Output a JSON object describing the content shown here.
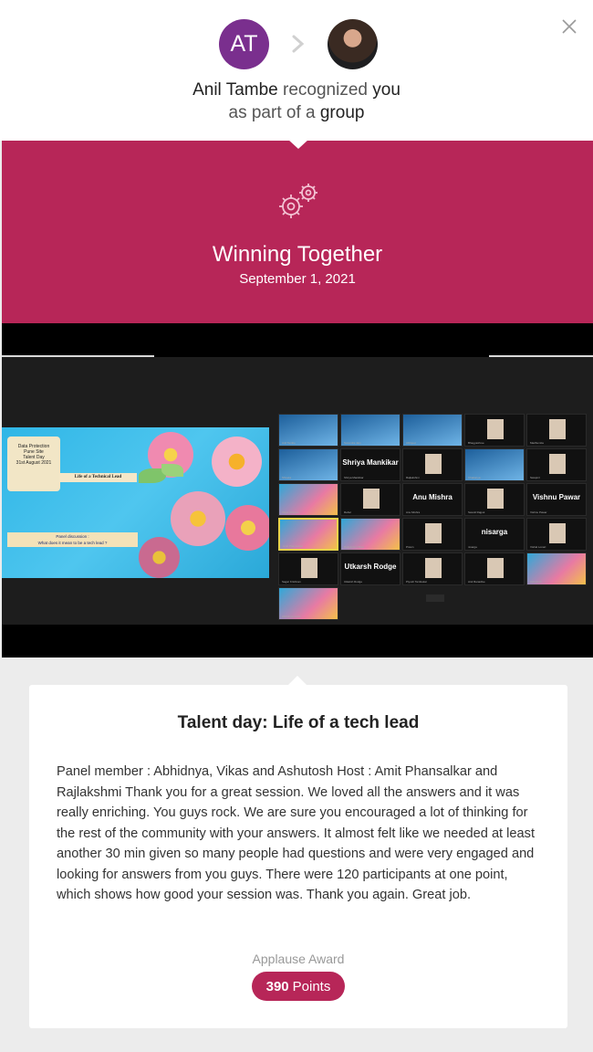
{
  "header": {
    "giver_initials": "AT",
    "giver_name": "Anil Tambe",
    "recognized_text": "recognized",
    "recipient": "you",
    "line2_prefix": "as part of a",
    "line2_group": "group"
  },
  "award": {
    "title": "Winning Together",
    "date": "September 1, 2021",
    "icon": "gears-icon"
  },
  "media": {
    "slide": {
      "scroll_lines": [
        "Data Protection",
        "Pune Site",
        "Talent Day",
        "31st August 2021"
      ],
      "title": "Life of a Technical Lead",
      "panel_line1": "Panel discussion :",
      "panel_line2": "What does it mean to be a tech lead ?"
    },
    "participants": [
      {
        "name": "",
        "sub": "Anil Tambe"
      },
      {
        "name": "",
        "sub": "Surendra Jain"
      },
      {
        "name": "",
        "sub": "Abhijeet"
      },
      {
        "name": "",
        "sub": "Bhagyashree"
      },
      {
        "name": "",
        "sub": "Madhumita"
      },
      {
        "name": "",
        "sub": "Shweta"
      },
      {
        "name": "Shriya Mankikar",
        "sub": "Shriya Mankikar"
      },
      {
        "name": "",
        "sub": "Rajlakshmi"
      },
      {
        "name": "",
        "sub": "Chaitanya"
      },
      {
        "name": "",
        "sub": "Swapnil"
      },
      {
        "name": "",
        "sub": "Vikas Chavan"
      },
      {
        "name": "",
        "sub": "Rahul"
      },
      {
        "name": "Anu Mishra",
        "sub": "Anu Mishra"
      },
      {
        "name": "",
        "sub": "Swanil Rajput"
      },
      {
        "name": "Vishnu Pawar",
        "sub": "Vishnu Pawar"
      },
      {
        "name": "",
        "sub": "Amit Phansalkar"
      },
      {
        "name": "",
        "sub": "Rajlakshmi Bhat"
      },
      {
        "name": "",
        "sub": "Pravin"
      },
      {
        "name": "nisarga",
        "sub": "nisarga"
      },
      {
        "name": "",
        "sub": "Vishal Lonari"
      },
      {
        "name": "",
        "sub": "Sagar Krishnan"
      },
      {
        "name": "Utkarsh Rodge",
        "sub": "Utkarsh Rodge"
      },
      {
        "name": "",
        "sub": "Piyush Tambekar"
      },
      {
        "name": "",
        "sub": "Atul Ranadive"
      },
      {
        "name": "",
        "sub": "Ashutosh"
      },
      {
        "name": "",
        "sub": "Abhidnya Joshi"
      }
    ]
  },
  "card": {
    "title": "Talent day: Life of a tech lead",
    "body": "Panel member : Abhidnya, Vikas and Ashutosh Host : Amit Phansalkar and Rajlakshmi Thank you for a great session. We loved all the answers and it was really enriching. You guys rock. We are sure you encouraged a lot of thinking for the rest of the community with your answers. It almost felt like we needed at least another 30 min given so many people had questions and were very engaged and looking for answers from you guys. There were 120 participants at one point, which shows how good your session was. Thank you again. Great job.",
    "award_label": "Applause Award",
    "points_value": "390",
    "points_unit": "Points"
  },
  "colors": {
    "brand": "#b72658",
    "avatar": "#7a2f8e"
  }
}
